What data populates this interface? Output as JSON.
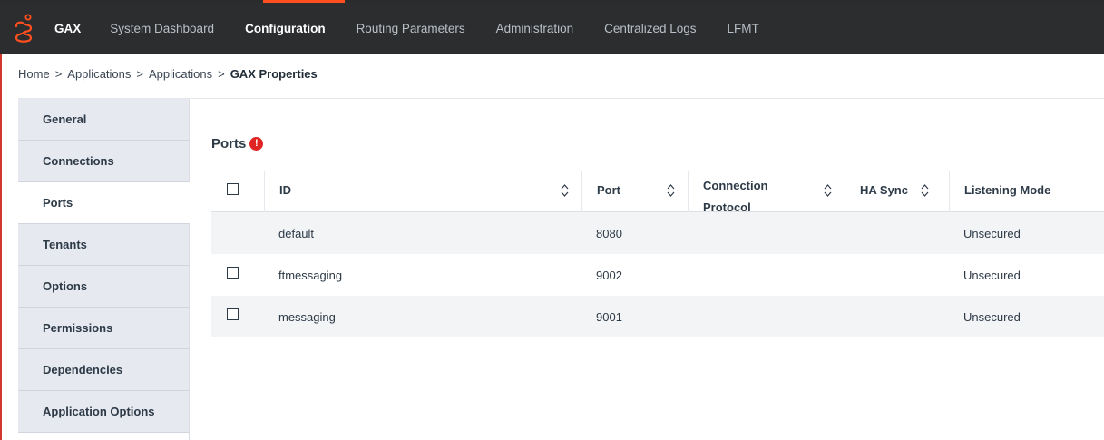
{
  "nav": {
    "brand": "GAX",
    "items": [
      {
        "label": "System Dashboard",
        "active": false
      },
      {
        "label": "Configuration",
        "active": true
      },
      {
        "label": "Routing Parameters",
        "active": false
      },
      {
        "label": "Administration",
        "active": false
      },
      {
        "label": "Centralized Logs",
        "active": false
      },
      {
        "label": "LFMT",
        "active": false
      }
    ]
  },
  "breadcrumb": {
    "items": [
      "Home",
      "Applications",
      "Applications"
    ],
    "separator": ">",
    "current": "GAX Properties"
  },
  "sidebar": {
    "items": [
      {
        "label": "General",
        "active": false
      },
      {
        "label": "Connections",
        "active": false
      },
      {
        "label": "Ports",
        "active": true
      },
      {
        "label": "Tenants",
        "active": false
      },
      {
        "label": "Options",
        "active": false
      },
      {
        "label": "Permissions",
        "active": false
      },
      {
        "label": "Dependencies",
        "active": false
      },
      {
        "label": "Application Options",
        "active": false
      }
    ]
  },
  "main": {
    "title": "Ports",
    "alert_icon": "!",
    "table": {
      "columns": {
        "id": "ID",
        "port": "Port",
        "connection": "Connection Protocol",
        "ha_sync": "HA Sync",
        "listening": "Listening Mode"
      },
      "rows": [
        {
          "has_checkbox": false,
          "id": "default",
          "port": "8080",
          "connection": "",
          "ha_sync": "",
          "listening": "Unsecured"
        },
        {
          "has_checkbox": true,
          "id": "ftmessaging",
          "port": "9002",
          "connection": "",
          "ha_sync": "",
          "listening": "Unsecured"
        },
        {
          "has_checkbox": true,
          "id": "messaging",
          "port": "9001",
          "connection": "",
          "ha_sync": "",
          "listening": "Unsecured"
        }
      ]
    }
  },
  "colors": {
    "nav_bg": "#2b2d2f",
    "accent": "#ff4f1f",
    "alert": "#e02424",
    "sidebar_bg": "#e6e9ef"
  }
}
